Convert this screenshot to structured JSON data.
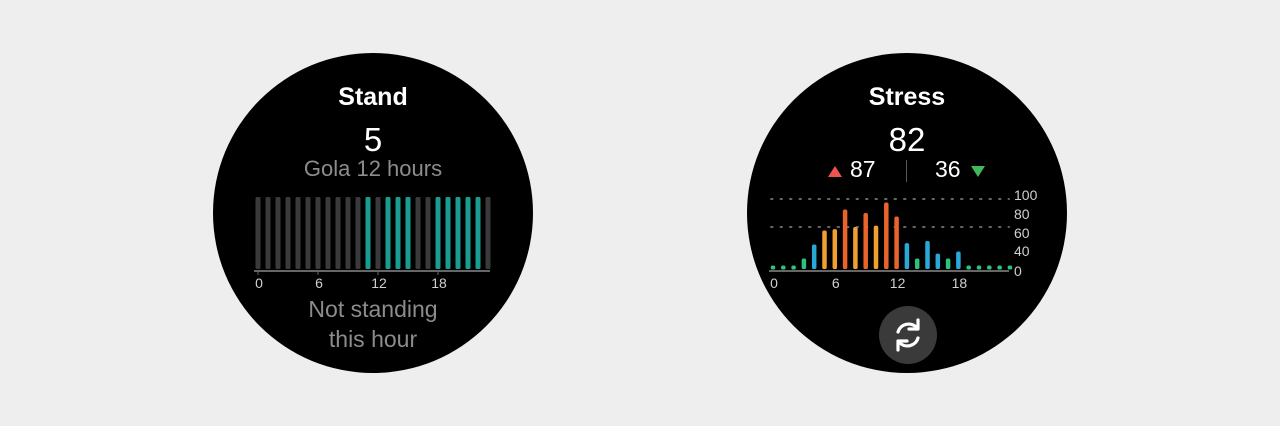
{
  "stand": {
    "title": "Stand",
    "value": "5",
    "goal": "Gola 12 hours",
    "status_line1": "Not standing",
    "status_line2": "this hour",
    "colors": {
      "active": "#1b9c90",
      "inactive": "#3a3a3a",
      "baseline": "#666666"
    }
  },
  "stress": {
    "title": "Stress",
    "value": "82",
    "high": "87",
    "low": "36",
    "colors": {
      "high_arrow": "#ef5350",
      "low_arrow": "#43b85a"
    },
    "refresh_icon": "refresh-icon"
  },
  "chart_data": [
    {
      "type": "bar",
      "chart": "stand-hourly",
      "x": [
        0,
        1,
        2,
        3,
        4,
        5,
        6,
        7,
        8,
        9,
        10,
        11,
        12,
        13,
        14,
        15,
        16,
        17,
        18,
        19,
        20,
        21,
        22,
        23
      ],
      "values": [
        0,
        0,
        0,
        0,
        0,
        0,
        0,
        0,
        0,
        0,
        0,
        1,
        0,
        1,
        1,
        1,
        0,
        0,
        1,
        1,
        1,
        1,
        1,
        0
      ],
      "tick_labels": [
        "0",
        "6",
        "12",
        "18"
      ],
      "tick_positions": [
        0,
        6,
        12,
        18
      ]
    },
    {
      "type": "bar",
      "chart": "stress-hourly",
      "x": [
        0,
        1,
        2,
        3,
        4,
        5,
        6,
        7,
        8,
        9,
        10,
        11,
        12,
        13,
        14,
        15,
        16,
        17,
        18,
        19,
        20,
        21,
        22,
        23
      ],
      "values": [
        5,
        5,
        5,
        15,
        35,
        55,
        57,
        85,
        60,
        80,
        62,
        95,
        75,
        37,
        15,
        40,
        22,
        15,
        25,
        5,
        5,
        5,
        5,
        5
      ],
      "colors": [
        "#2ec27e",
        "#2ec27e",
        "#2ec27e",
        "#2ec27e",
        "#2aa8d8",
        "#f0a030",
        "#f0a030",
        "#e8642a",
        "#f0a030",
        "#e8642a",
        "#f0a030",
        "#e8642a",
        "#e8642a",
        "#2aa8d8",
        "#2ec27e",
        "#2aa8d8",
        "#2aa8d8",
        "#2ec27e",
        "#2aa8d8",
        "#2ec27e",
        "#2ec27e",
        "#2ec27e",
        "#2ec27e",
        "#2ec27e"
      ],
      "ylim": [
        0,
        100
      ],
      "y_ticks": [
        "100",
        "80",
        "60",
        "40",
        "0"
      ],
      "x_tick_labels": [
        "0",
        "6",
        "12",
        "18"
      ],
      "x_tick_positions": [
        0,
        6,
        12,
        18
      ]
    }
  ]
}
